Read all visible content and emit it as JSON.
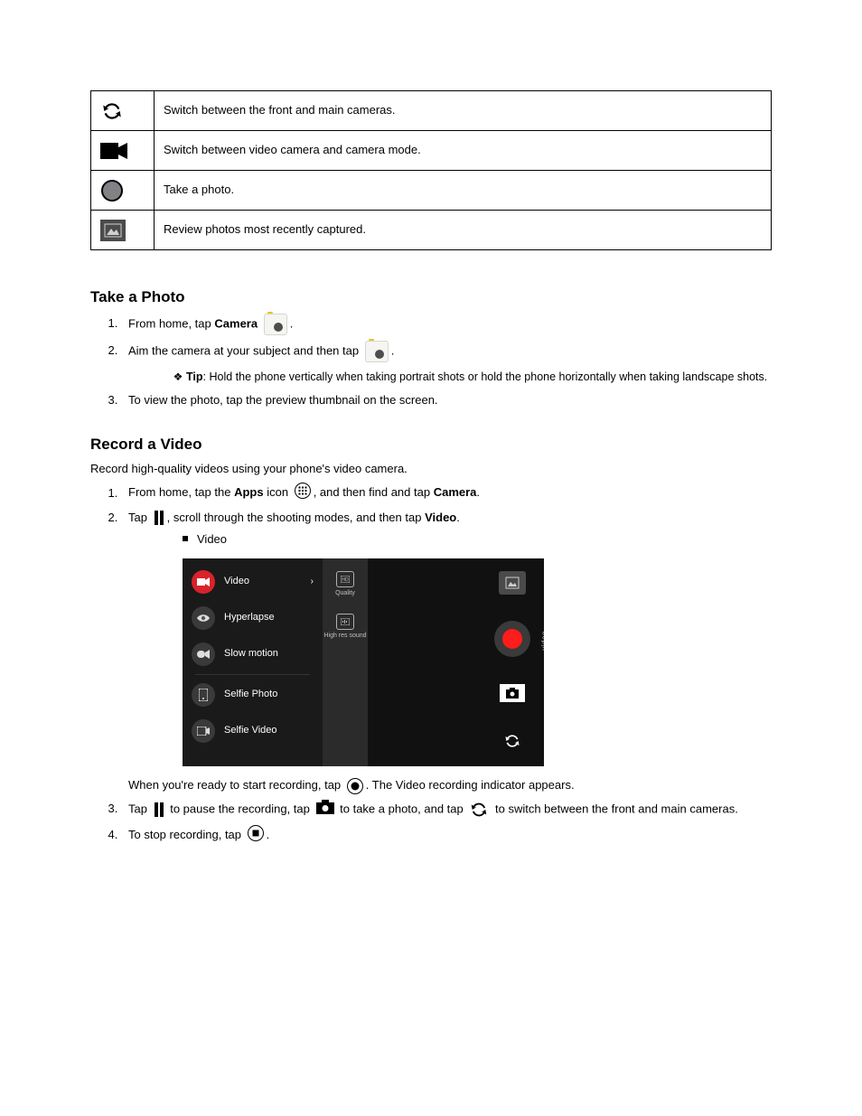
{
  "table": {
    "r1_desc": "Switch between the front and main cameras.",
    "r2_desc": "Switch between video camera and camera mode.",
    "r3_desc": "Take a photo.",
    "r4_desc": "Review photos most recently captured."
  },
  "s_take": {
    "heading": "Take a Photo",
    "step1_a": "From home, tap",
    "step1_b": "Camera",
    "step1_c": ".",
    "step2_a": "Aim the camera at your subject and then tap",
    "step2_b": ".",
    "tip_label": "Tip",
    "tip_text": ": Hold the phone vertically when taking portrait shots or hold the phone horizontally when taking landscape shots.",
    "step3": "To view the photo, tap the preview thumbnail on the screen."
  },
  "s_rec": {
    "heading": "Record a Video",
    "intro": "Record high-quality videos using your phone's video camera.",
    "step1_a": "From home, tap the",
    "step1_b": "Apps",
    "step1_c": "icon",
    "step1_d": ", and then find and tap",
    "step1_e": "Camera",
    "step1_f": ".",
    "step2_a": "Tap",
    "step2_b": ", scroll through the shooting modes, and then tap",
    "step2_c": "Video",
    "step2_d": ".",
    "sub_video": "Video",
    "post_img_a": "When you're ready to start recording, tap",
    "post_img_b": ". The Video recording indicator appears.",
    "step3_a": "Tap",
    "step3_b": "to pause the recording, tap",
    "step3_c": "to take a photo, and tap",
    "step3_d": "to switch between the front and main cameras.",
    "step4_a": "To stop recording, tap",
    "step4_b": "."
  },
  "phone": {
    "modes": {
      "video": "Video",
      "hyperlapse": "Hyperlapse",
      "slowmo": "Slow motion",
      "selfie_photo": "Selfie Photo",
      "selfie_video": "Selfie Video"
    },
    "opts": {
      "quality": "Quality",
      "hires": "High res sound"
    },
    "vert_label": "video"
  }
}
